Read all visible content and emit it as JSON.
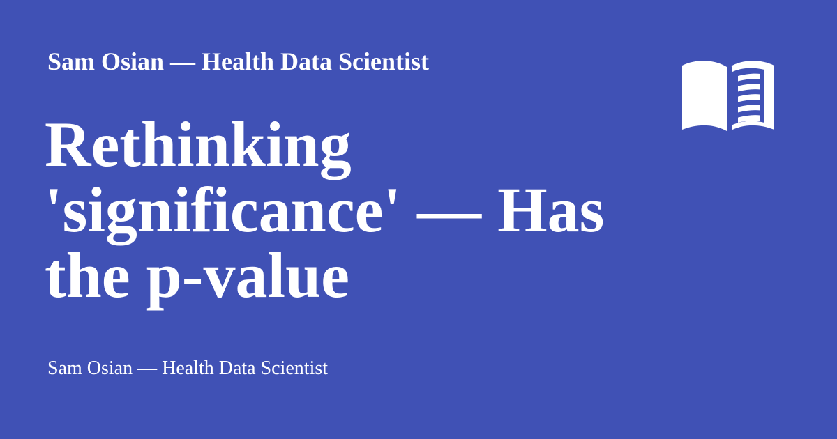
{
  "card": {
    "site_name": "Sam Osian — Health Data Scientist",
    "title": "Rethinking 'significance' — Has the p-value",
    "byline": "Sam Osian — Health Data Scientist",
    "icon": "open-book-icon",
    "colors": {
      "background": "#4051b5",
      "text": "#ffffff"
    }
  }
}
